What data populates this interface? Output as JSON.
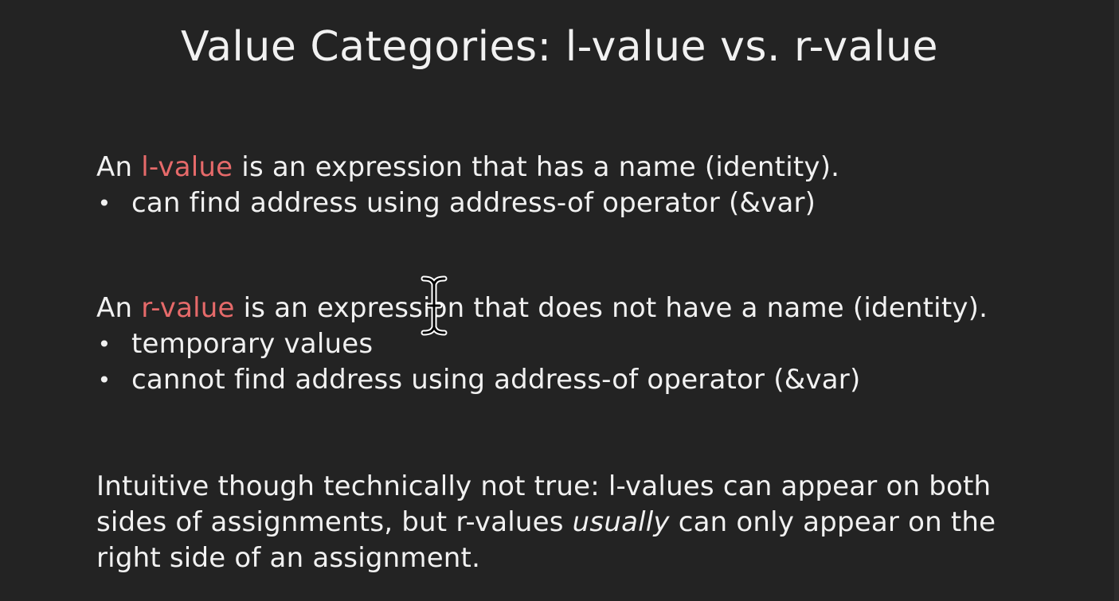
{
  "slide": {
    "title": "Value Categories: l-value vs. r-value",
    "lvalue": {
      "prefix": "An ",
      "term": "l-value",
      "suffix": " is an expression that has a name (identity).",
      "bullets": [
        "can find address using address-of operator (&var)"
      ]
    },
    "rvalue": {
      "prefix": "An ",
      "term": "r-value",
      "suffix": " is an expression that does not have a name (identity).",
      "bullets": [
        "temporary values",
        "cannot find address using address-of operator (&var)"
      ]
    },
    "note": {
      "line1": "Intuitive though technically not true: l-values can appear on both",
      "line2_before": "sides of assignments, but r-values ",
      "line2_emphasis": "usually",
      "line2_after": " can only appear on the",
      "line3": "right side of an assignment."
    }
  },
  "colors": {
    "background": "#232323",
    "text": "#f1f1f1",
    "highlight": "#e66a6a"
  },
  "icons": {
    "bullet": "•",
    "cursor": "text-cursor-icon"
  }
}
